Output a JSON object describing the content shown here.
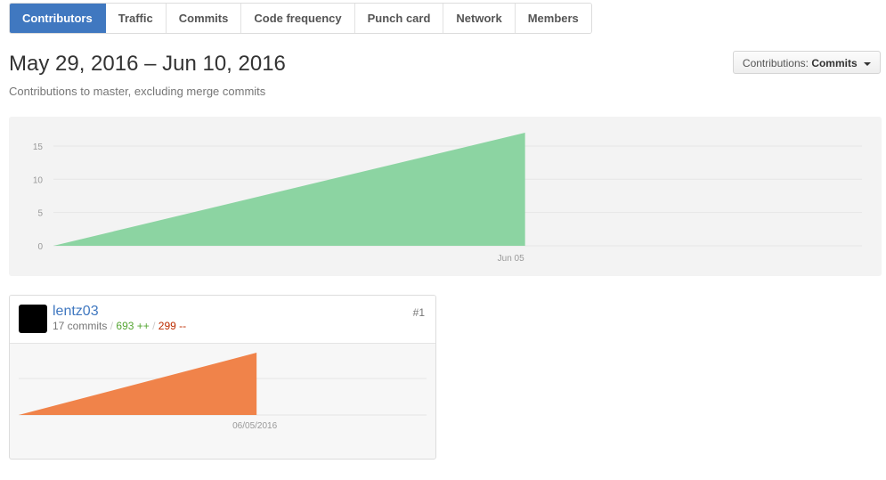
{
  "tabs": [
    {
      "label": "Contributors",
      "active": true
    },
    {
      "label": "Traffic"
    },
    {
      "label": "Commits"
    },
    {
      "label": "Code frequency"
    },
    {
      "label": "Punch card"
    },
    {
      "label": "Network"
    },
    {
      "label": "Members"
    }
  ],
  "header": {
    "title": "May 29, 2016 – Jun 10, 2016",
    "subtitle": "Contributions to master, excluding merge commits",
    "contrib_label": "Contributions:",
    "contrib_value": "Commits"
  },
  "chart_data": [
    {
      "type": "area",
      "x": [
        "2016-05-29",
        "2016-06-05"
      ],
      "y": [
        0,
        17
      ],
      "y_ticks": [
        "0",
        "5",
        "10",
        "15"
      ],
      "x_tick_labels": [
        "Jun 05"
      ],
      "ylim": [
        0,
        17
      ],
      "grid": true,
      "color": "#8cd4a2"
    },
    {
      "type": "area",
      "x": [
        "2016-05-29",
        "2016-06-05"
      ],
      "y": [
        0,
        17
      ],
      "x_tick_labels": [
        "06/05/2016"
      ],
      "grid": true,
      "color": "#f0834a"
    }
  ],
  "contributor": {
    "username": "lentz03",
    "commits": "17 commits",
    "additions": "693 ++",
    "deletions": "299 --",
    "rank": "#1"
  }
}
